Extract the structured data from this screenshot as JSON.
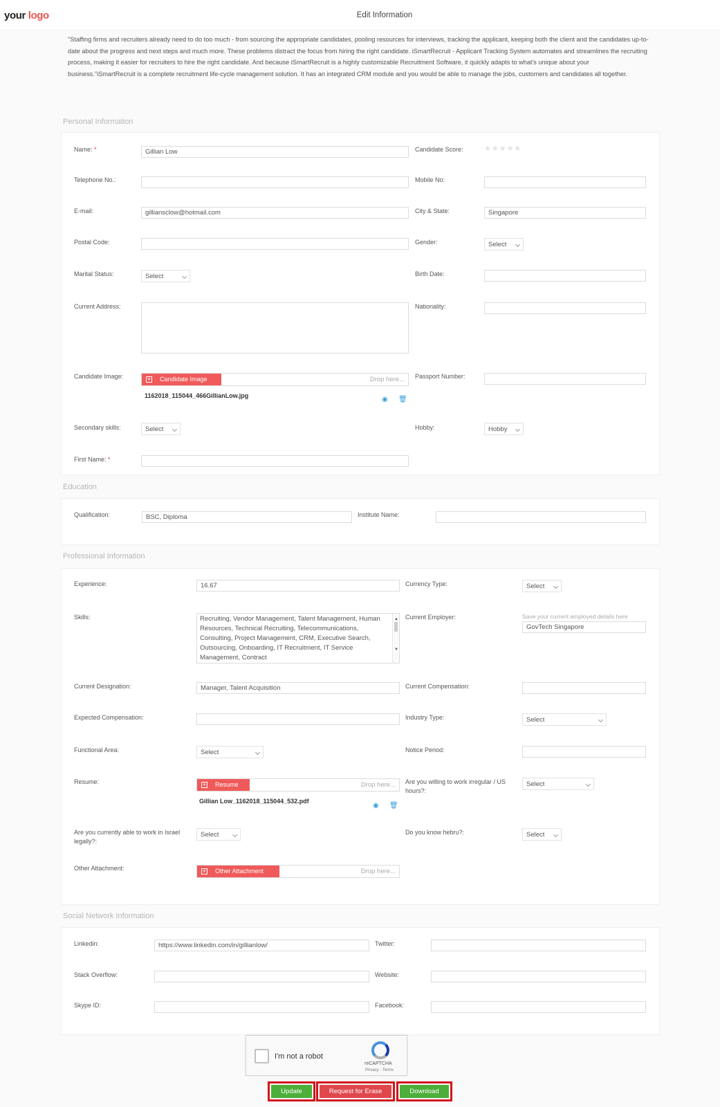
{
  "header": {
    "logo_your": "your",
    "logo_logo": "logo",
    "title": "Edit Information"
  },
  "intro": "\"Staffing firms and recruiters already need to do too much - from sourcing the appropriate candidates, pooling resources for interviews, tracking the applicant, keeping both the client and the candidates up-to-date about the progress and next steps and much more. These problems distract the focus from hiring the right candidate. iSmartRecruit - Applicant Tracking System automates and streamlines the recruiting process, making it easier for recruiters to hire the right candidate. And because iSmartRecruit is a highly customizable Recruitment Software, it quickly adapts to what's unique about your business.\"iSmartRecruit is a complete recruitment life-cycle management solution. It has an integrated CRM module and you would be able to manage the jobs, customers and candidates all together.",
  "sections": {
    "personal": "Personal Information",
    "education": "Education",
    "professional": "Professional Information",
    "social": "Social Network Information"
  },
  "personal": {
    "name_label": "Name:",
    "name_value": "Gillian Low",
    "score_label": "Candidate Score:",
    "score_stars": "★★★★★",
    "score_value": 0,
    "telephone_label": "Telephone No.:",
    "telephone_value": "",
    "mobile_label": "Mobile No:",
    "mobile_value": "",
    "email_label": "E-mail:",
    "email_value": "gilliansclow@hotmail.com",
    "city_label": "City & State:",
    "city_value": "Singapore",
    "postal_label": "Postal Code:",
    "postal_value": "",
    "gender_label": "Gender:",
    "gender_value": "Select",
    "marital_label": "Marital Status:",
    "marital_value": "Select",
    "birth_label": "Birth Date:",
    "birth_value": "",
    "address_label": "Current Address:",
    "address_value": "",
    "nationality_label": "Nationality:",
    "nationality_value": "",
    "image_label": "Candidate Image:",
    "image_button": "Candidate Image",
    "image_drop": "Drop here...",
    "image_file": "1162018_115044_466GillianLow.jpg",
    "passport_label": "Passport Number:",
    "passport_value": "",
    "secondary_label": "Secondary skills:",
    "secondary_value": "Select",
    "hobby_label": "Hobby:",
    "hobby_value": "Hobby",
    "firstname_label": "First Name:",
    "firstname_value": ""
  },
  "education": {
    "qualification_label": "Qualification:",
    "qualification_value": "BSC, Diploma",
    "institute_label": "Institute Name:",
    "institute_value": ""
  },
  "professional": {
    "experience_label": "Experience:",
    "experience_value": "16.67",
    "currency_label": "Currency Type:",
    "currency_value": "Select",
    "skills_label": "Skills:",
    "skills_value": "Recruiting, Vendor Management, Talent Management, Human Resources, Technical Recruiting, Telecommunications, Consulting, Project Management, CRM, Executive Search, Outsourcing, Onboarding, IT Recruitment, IT Service Management, Contract",
    "employer_label": "Current Employer:",
    "employer_hint": "Save your current employed details here",
    "employer_value": "GovTech Singapore",
    "designation_label": "Current Designation:",
    "designation_value": "Manager, Talent Acquisition",
    "compensation_label": "Current Compensation:",
    "compensation_value": "",
    "expected_label": "Expected Compensation:",
    "expected_value": "",
    "industry_label": "Industry Type:",
    "industry_value": "Select",
    "functional_label": "Functional Area:",
    "functional_value": "Select",
    "notice_label": "Notice Period:",
    "notice_value": "",
    "resume_label": "Resume:",
    "resume_button": "Resume",
    "resume_drop": "Drop here...",
    "resume_file": "Gillian Low_1162018_115044_532.pdf",
    "irregular_label": "Are you willing to work irregular / US hours?:",
    "irregular_value": "Select",
    "israel_label": "Are you currently able to work in Israel legally?:",
    "israel_value": "Select",
    "hebrew_label": "Do you know hebru?:",
    "hebrew_value": "Select",
    "attachment_label": "Other Attachment:",
    "attachment_button": "Other Attachment",
    "attachment_drop": "Drop here..."
  },
  "social": {
    "linkedin_label": "Linkedin:",
    "linkedin_value": "https://www.linkedin.com/in/gillianlow/",
    "twitter_label": "Twitter:",
    "twitter_value": "",
    "stackoverflow_label": "Stack Overflow:",
    "stackoverflow_value": "",
    "website_label": "Website:",
    "website_value": "",
    "skype_label": "Skype ID:",
    "skype_value": "",
    "facebook_label": "Facebook:",
    "facebook_value": ""
  },
  "captcha": {
    "label": "I'm not a robot",
    "brand": "reCAPTCHA",
    "terms": "Privacy - Terms"
  },
  "buttons": {
    "update": "Update",
    "erase": "Request for Erase",
    "download": "Download"
  },
  "colors": {
    "accent_red": "#f05a5a",
    "button_green": "#4caf3a",
    "button_red": "#e0474c",
    "highlight_border": "#d0161b"
  }
}
